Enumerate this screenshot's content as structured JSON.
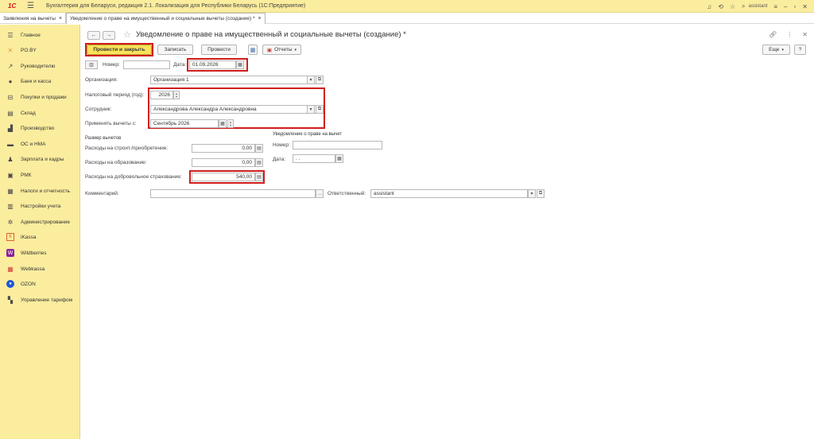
{
  "app": {
    "logo": "1С",
    "title": "Бухгалтерия для Беларуси, редакция 2.1. Локализация для Республики Беларусь   (1С:Предприятие)",
    "user": "assistant",
    "icons": [
      "bell-icon",
      "history-icon",
      "star-icon",
      "search-icon",
      "settings-icon",
      "minimize-icon",
      "maximize-icon",
      "close-icon"
    ]
  },
  "tabs": [
    {
      "label": "Заявления на вычеты",
      "active": false
    },
    {
      "label": "Уведомление о праве на имущественный и социальные вычеты (создание) *",
      "active": true
    }
  ],
  "sidebar": {
    "items": [
      {
        "label": "Главное",
        "icon": "menu-lines-icon"
      },
      {
        "label": "PO.BY",
        "icon": "po-by-icon"
      },
      {
        "label": "Руководителю",
        "icon": "trend-icon"
      },
      {
        "label": "Банк и касса",
        "icon": "bank-icon"
      },
      {
        "label": "Покупки и продажи",
        "icon": "cart-icon"
      },
      {
        "label": "Склад",
        "icon": "warehouse-icon"
      },
      {
        "label": "Производство",
        "icon": "factory-icon"
      },
      {
        "label": "ОС и НМА",
        "icon": "truck-icon"
      },
      {
        "label": "Зарплата и кадры",
        "icon": "person-icon"
      },
      {
        "label": "РМК",
        "icon": "cash-register-icon"
      },
      {
        "label": "Налоги и отчетность",
        "icon": "taxes-icon"
      },
      {
        "label": "Настройки учета",
        "icon": "accounting-settings-icon"
      },
      {
        "label": "Администрирование",
        "icon": "gear-icon"
      },
      {
        "label": "iKassa",
        "icon": "ikassa-icon"
      },
      {
        "label": "Wildberries",
        "icon": "wildberries-icon"
      },
      {
        "label": "Webkassa",
        "icon": "webkassa-icon"
      },
      {
        "label": "OZON",
        "icon": "ozon-icon"
      },
      {
        "label": "Управление тарифом",
        "icon": "tariff-icon"
      }
    ]
  },
  "form": {
    "title": "Уведомление о праве на имущественный и социальные вычеты (создание) *",
    "toolbar": {
      "post_close": "Провести и закрыть",
      "save": "Записать",
      "post": "Провести",
      "reports": "Отчеты",
      "more": "Еще",
      "help": "?"
    },
    "number_label": "Номер:",
    "number_value": "",
    "date_label": "Дата:",
    "date_value": "01.09.2026",
    "organization_label": "Организация:",
    "organization_value": "Организация 1",
    "tax_period_label": "Налоговый период (год):",
    "tax_period_value": "2026",
    "employee_label": "Сотрудник:",
    "employee_value": "Александрова Александра Александровна",
    "apply_from_label": "Применять вычеты с:",
    "apply_from_value": "Сентябрь 2026",
    "deductions_header": "Размер вычетов",
    "construction_label": "Расходы на строит./приобретение:",
    "construction_value": "0,00",
    "education_label": "Расходы на образование:",
    "education_value": "0,00",
    "insurance_label": "Расходы на добровольное страхование:",
    "insurance_value": "540,00",
    "notice_header": "Уведомление о праве на вычет",
    "notice_number_label": "Номер:",
    "notice_number_value": "",
    "notice_date_label": "Дата:",
    "notice_date_value": " .  .",
    "comment_label": "Комментарий:",
    "comment_value": "",
    "responsible_label": "Ответственный:",
    "responsible_value": "assistant"
  },
  "colors": {
    "accent_yellow": "#fbed9e",
    "primary_button": "#fbe35a",
    "highlight_red": "#d11c1c"
  }
}
